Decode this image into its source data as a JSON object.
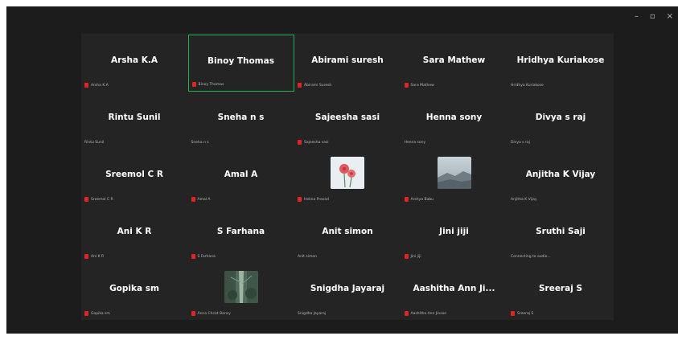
{
  "window": {
    "controls": [
      "–",
      "▫",
      "×"
    ]
  },
  "participants": [
    {
      "name": "Arsha K.A",
      "label": "Arsha K.A",
      "muted": true,
      "picture": null,
      "active": false
    },
    {
      "name": "Binoy Thomas",
      "label": "Binoy Thomas",
      "muted": true,
      "picture": null,
      "active": true
    },
    {
      "name": "Abirami suresh",
      "label": "Abirami Suresh",
      "muted": true,
      "picture": null,
      "active": false
    },
    {
      "name": "Sara Mathew",
      "label": "Sara Mathew",
      "muted": true,
      "picture": null,
      "active": false
    },
    {
      "name": "Hridhya Kuriakose",
      "label": "Hridhya Kuriakose",
      "muted": false,
      "picture": null,
      "active": false
    },
    {
      "name": "Rintu Sunil",
      "label": "Rintu Sunil",
      "muted": false,
      "picture": null,
      "active": false
    },
    {
      "name": "Sneha n s",
      "label": "Sneha n s",
      "muted": false,
      "picture": null,
      "active": false
    },
    {
      "name": "Sajeesha sasi",
      "label": "Sajeesha sasi",
      "muted": true,
      "picture": null,
      "active": false
    },
    {
      "name": "Henna sony",
      "label": "Henna sony",
      "muted": false,
      "picture": null,
      "active": false
    },
    {
      "name": "Divya s raj",
      "label": "Divya s raj",
      "muted": false,
      "picture": null,
      "active": false
    },
    {
      "name": "Sreemol C R",
      "label": "Sreemol C R",
      "muted": true,
      "picture": null,
      "active": false
    },
    {
      "name": "Amal A",
      "label": "Amal A",
      "muted": true,
      "picture": null,
      "active": false
    },
    {
      "name": "",
      "label": "Helina Prasad",
      "muted": true,
      "picture": "flowers",
      "active": false
    },
    {
      "name": "",
      "label": "Arshya Babu",
      "muted": true,
      "picture": "landscape",
      "active": false
    },
    {
      "name": "Anjitha K Vijay",
      "label": "Anjitha K Vijay",
      "muted": false,
      "picture": null,
      "active": false
    },
    {
      "name": "Ani K R",
      "label": "Ani K R",
      "muted": true,
      "picture": null,
      "active": false
    },
    {
      "name": "S Farhana",
      "label": "S Farhana",
      "muted": true,
      "picture": null,
      "active": false
    },
    {
      "name": "Anit simon",
      "label": "Anit simon",
      "muted": false,
      "picture": null,
      "active": false
    },
    {
      "name": "Jini jiji",
      "label": "Jini jiji",
      "muted": true,
      "picture": null,
      "active": false
    },
    {
      "name": "Sruthi Saji",
      "label": "Connecting to audio...",
      "muted": false,
      "picture": null,
      "active": false
    },
    {
      "name": "Gopika sm",
      "label": "Gopika sm",
      "muted": true,
      "picture": null,
      "active": false
    },
    {
      "name": "",
      "label": "Anna Christ Bency",
      "muted": true,
      "picture": "forest",
      "active": false
    },
    {
      "name": "Snigdha Jayaraj",
      "label": "Snigdha Jayaraj",
      "muted": false,
      "picture": null,
      "active": false
    },
    {
      "name": "Aashitha Ann Ji...",
      "label": "Aashitha Ann Jinson",
      "muted": true,
      "picture": null,
      "active": false
    },
    {
      "name": "Sreeraj S",
      "label": "Sreeraj S",
      "muted": true,
      "picture": null,
      "active": false
    }
  ],
  "colors": {
    "background": "#1c1c1c",
    "tile": "#242424",
    "active_border": "#23b14d",
    "muted_mic": "#e02424"
  }
}
